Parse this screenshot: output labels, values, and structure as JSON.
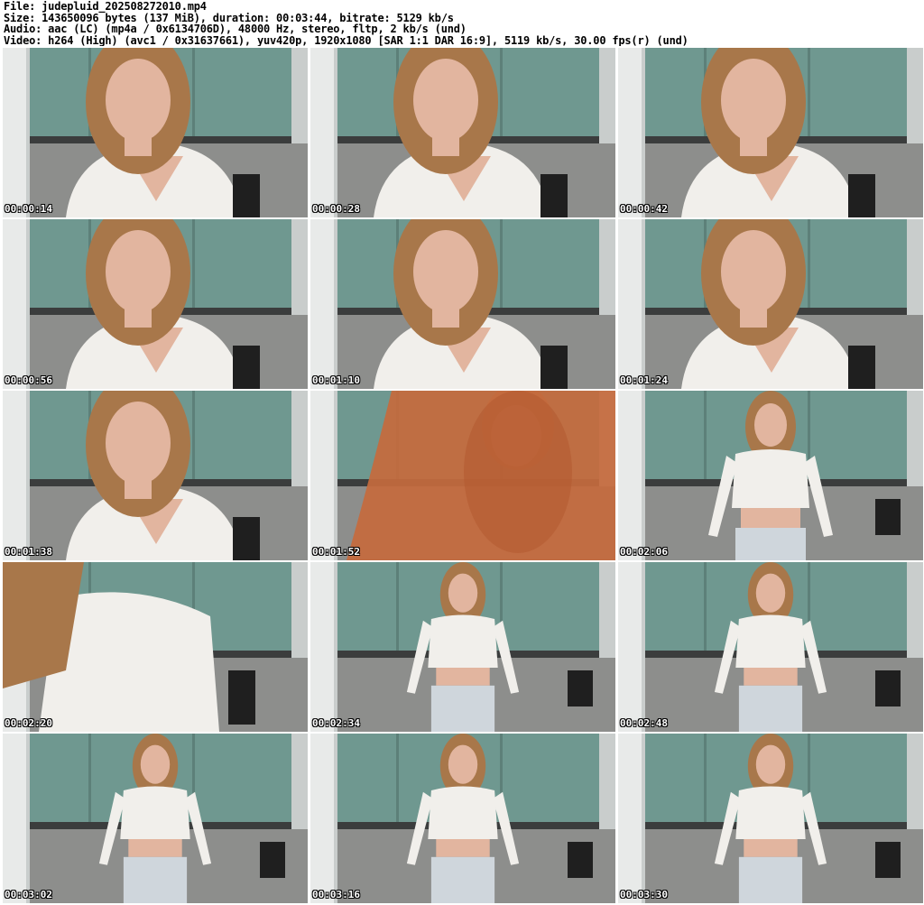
{
  "header": {
    "file": "File: judepluid_202508272010.mp4",
    "size": "Size: 143650096 bytes (137 MiB), duration: 00:03:44, bitrate: 5129 kb/s",
    "audio": "Audio: aac (LC) (mp4a / 0x6134706D), 48000 Hz, stereo, fltp, 2 kb/s (und)",
    "video": "Video: h264 (High) (avc1 / 0x31637661), yuv420p, 1920x1080 [SAR 1:1 DAR 16:9], 5119 kb/s, 30.00 fps(r) (und)"
  },
  "thumbnails": [
    {
      "time": "00:00:14",
      "scene": "seated-close"
    },
    {
      "time": "00:00:28",
      "scene": "seated-close"
    },
    {
      "time": "00:00:42",
      "scene": "seated-close"
    },
    {
      "time": "00:00:56",
      "scene": "seated-close"
    },
    {
      "time": "00:01:10",
      "scene": "seated-close"
    },
    {
      "time": "00:01:24",
      "scene": "seated-close"
    },
    {
      "time": "00:01:38",
      "scene": "seated-close"
    },
    {
      "time": "00:01:52",
      "scene": "hand-blur"
    },
    {
      "time": "00:02:06",
      "scene": "standing-mid"
    },
    {
      "time": "00:02:20",
      "scene": "close-torso"
    },
    {
      "time": "00:02:34",
      "scene": "standing-full"
    },
    {
      "time": "00:02:48",
      "scene": "standing-full"
    },
    {
      "time": "00:03:02",
      "scene": "standing-full"
    },
    {
      "time": "00:03:16",
      "scene": "standing-full"
    },
    {
      "time": "00:03:30",
      "scene": "standing-full"
    }
  ],
  "colors": {
    "wall": "#c9cdcc",
    "cabinet": "#6f9890",
    "cabinet_dark": "#5d8079",
    "tile": "#8d8e8c",
    "hair": "#a8774a",
    "skin": "#e2b59f",
    "top": "#f1efeb",
    "pants": "#cfd6dc",
    "hand": "#c66a3d"
  }
}
